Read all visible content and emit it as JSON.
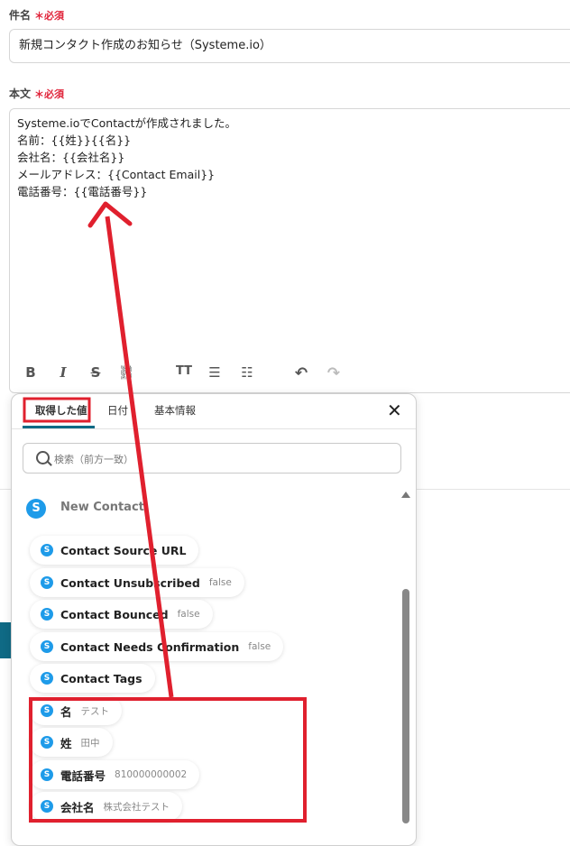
{
  "subject": {
    "label": "件名",
    "required_mark": "＊必須",
    "value": "新規コンタクト作成のお知らせ（Systeme.io）"
  },
  "body": {
    "label": "本文",
    "required_mark": "＊必須",
    "lines": [
      "Systeme.ioでContactが作成されました。",
      "名前：{{姓}}{{名}}",
      "会社名：{{会社名}}",
      "メールアドレス：{{Contact Email}}",
      "電話番号：{{電話番号}}"
    ]
  },
  "toolbar": {
    "bold": "B",
    "italic": "I",
    "strike": "S",
    "link": "⛓",
    "text_size": "TT",
    "bullet_list": "☰",
    "ordered_list": "☷",
    "undo": "↶",
    "redo": "↷"
  },
  "panel": {
    "tabs": [
      "取得した値",
      "日付",
      "基本情報"
    ],
    "active_tab": 0,
    "close": "✕",
    "search_placeholder": "検索（前方一致）",
    "section_title": "New Contact",
    "badge": "S",
    "items": [
      {
        "name": "Contact Source URL",
        "value": ""
      },
      {
        "name": "Contact Unsubscribed",
        "value": "false"
      },
      {
        "name": "Contact Bounced",
        "value": "false"
      },
      {
        "name": "Contact Needs Confirmation",
        "value": "false"
      },
      {
        "name": "Contact Tags",
        "value": ""
      },
      {
        "name": "名",
        "value": "テスト"
      },
      {
        "name": "姓",
        "value": "田中"
      },
      {
        "name": "電話番号",
        "value": "810000000002"
      },
      {
        "name": "会社名",
        "value": "株式会社テスト"
      }
    ]
  },
  "colors": {
    "annotation_red": "#e0202e",
    "accent_teal": "#0f6a85",
    "badge_blue": "#1e9be9",
    "required_red": "#e0243a"
  }
}
